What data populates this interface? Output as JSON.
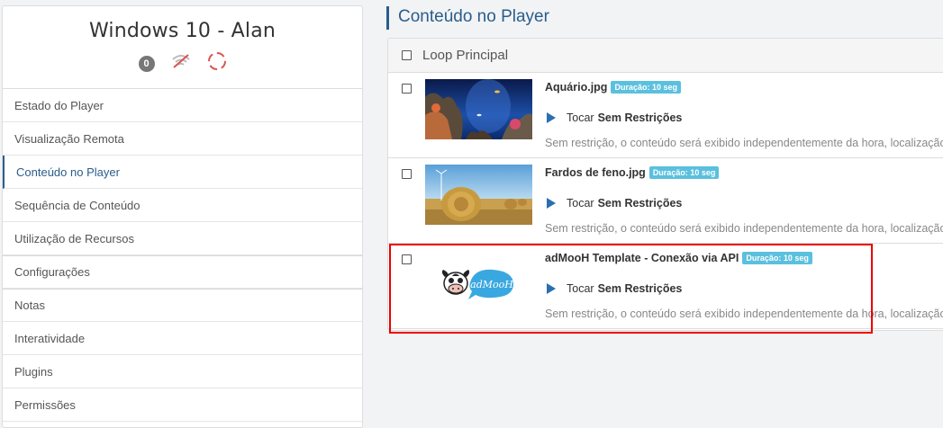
{
  "player": {
    "title": "Windows 10 - Alan",
    "badge_count": "0",
    "icons": [
      "wifi-off-icon",
      "target-icon"
    ]
  },
  "menu": {
    "items": [
      {
        "label": "Estado do Player"
      },
      {
        "label": "Visualização Remota"
      },
      {
        "label": "Conteúdo no Player",
        "active": true
      },
      {
        "label": "Sequência de Conteúdo"
      },
      {
        "label": "Utilização de Recursos"
      },
      {
        "label": "Configurações"
      },
      {
        "label": "Notas"
      },
      {
        "label": "Interatividade"
      },
      {
        "label": "Plugins"
      },
      {
        "label": "Permissões"
      }
    ]
  },
  "main": {
    "title": "Conteúdo no Player",
    "loop_label": "Loop Principal",
    "rows": [
      {
        "name": "Aquário.jpg",
        "duration": "Duração: 10 seg",
        "play": "Tocar",
        "restriction": "Sem Restrições",
        "desc": "Sem restrição, o conteúdo será exibido independentemente da hora, localização"
      },
      {
        "name": "Fardos de feno.jpg",
        "duration": "Duração: 10 seg",
        "play": "Tocar",
        "restriction": "Sem Restrições",
        "desc": "Sem restrição, o conteúdo será exibido independentemente da hora, localização"
      },
      {
        "name": "adMooH Template - Conexão via API",
        "duration": "Duração: 10 seg",
        "play": "Tocar",
        "restriction": "Sem Restrições",
        "desc": "Sem restrição, o conteúdo será exibido independentemente da hora, localização"
      }
    ]
  },
  "colors": {
    "accent": "#2a5d8c",
    "badge": "#5bc0de",
    "highlight": "#e00000"
  },
  "logo_text": "adMooH"
}
